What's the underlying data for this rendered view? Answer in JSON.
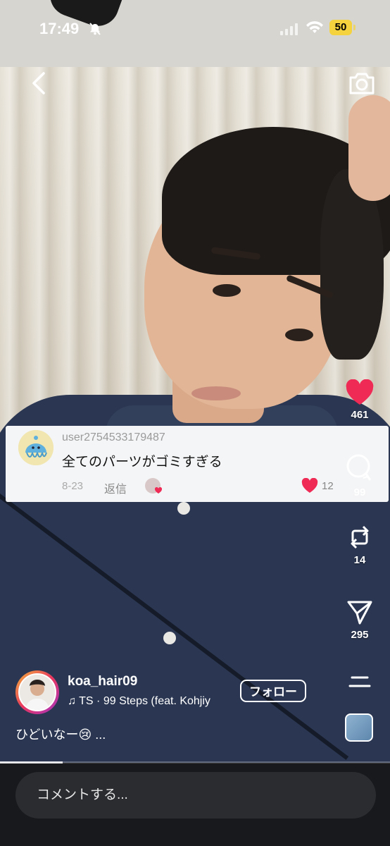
{
  "status_bar": {
    "time": "17:49",
    "battery": "50"
  },
  "comment": {
    "username": "user2754533179487",
    "text": "全てのパーツがゴミすぎる",
    "date": "8-23",
    "reply_label": "返信",
    "likes": "12"
  },
  "actions": {
    "likes": "461",
    "comments": "99",
    "reposts": "14",
    "shares": "295"
  },
  "author": {
    "username": "koa_hair09",
    "music": "TS · 99 Steps (feat. Kohjiy",
    "follow_label": "フォロー",
    "caption": "ひどいなー😢 ..."
  },
  "progress": 0.16,
  "comment_input": {
    "placeholder": "コメントする..."
  },
  "colors": {
    "heart": "#ee2a55",
    "bar_bg": "#17191c",
    "input_bg": "#2a2c30"
  }
}
